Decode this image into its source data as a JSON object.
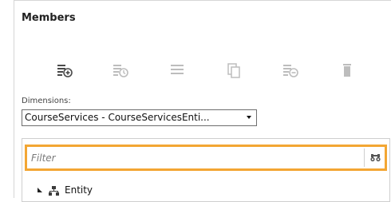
{
  "members": {
    "title": "Members"
  },
  "toolbar": {
    "buttons": [
      {
        "icon": "add-member-icon",
        "enabled": true
      },
      {
        "icon": "member-properties-icon",
        "enabled": false
      },
      {
        "icon": "list-icon",
        "enabled": false
      },
      {
        "icon": "copy-icon",
        "enabled": false
      },
      {
        "icon": "remove-member-icon",
        "enabled": false
      },
      {
        "icon": "delete-icon",
        "enabled": false
      }
    ]
  },
  "dimensions": {
    "label": "Dimensions:",
    "selected": "CourseServices - CourseServicesEnti..."
  },
  "filter": {
    "placeholder": "Filter",
    "value": ""
  },
  "tree": {
    "items": [
      {
        "label": "Entity",
        "expanded": true
      }
    ]
  },
  "colors": {
    "highlight": "#f3a633",
    "icon_enabled": "#4a4a4a",
    "icon_disabled": "#bdbdbd"
  }
}
